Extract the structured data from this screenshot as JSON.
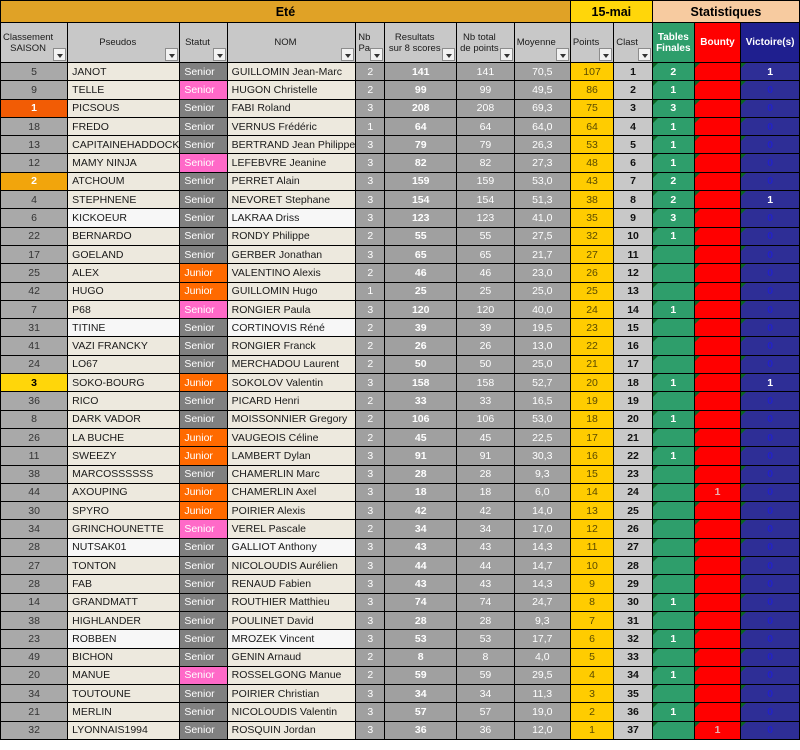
{
  "bands": {
    "season_title": "Eté",
    "date_label": "15-mai",
    "stats_label": "Statistiques"
  },
  "colors": {
    "season_band": "#E0A226",
    "date_band": "#FFD60A",
    "stats_band": "#F7CBA0",
    "tables_finales": "#2E9E6B",
    "bounty": "#FF0000",
    "victoires": "#1F1F8F",
    "points": "#FFCC00",
    "rank_gold1": "#F25C05",
    "rank_gold2": "#F2A50C",
    "rank_gold3": "#FFD60A",
    "statut_senior": "#808080",
    "statut_senior_female": "#FF69C8",
    "statut_junior": "#FF6A00"
  },
  "headers": [
    "Classement SAISON",
    "Pseudos",
    "Statut",
    "NOM",
    "Nb Pa",
    "Resultats sur 8 scores",
    "Nb total de points",
    "Moyenne",
    "Points",
    "Clast",
    "Tables Finales",
    "Bounty",
    "Victoire(s)"
  ],
  "rows": [
    {
      "rank": "5",
      "rank_hl": "",
      "pseudo": "JANOT",
      "statut": "Senior",
      "statut_type": "senior",
      "nom": "GUILLOMIN Jean-Marc",
      "nbpa": "2",
      "res8": "141",
      "nbtot": "141",
      "moy": "70,5",
      "pts": "107",
      "clst": "1",
      "tf": "2",
      "bounty": "",
      "vic": "1"
    },
    {
      "rank": "9",
      "rank_hl": "",
      "pseudo": "TELLE",
      "statut": "Senior",
      "statut_type": "senior-f",
      "nom": "HUGON Christelle",
      "nbpa": "2",
      "res8": "99",
      "nbtot": "99",
      "moy": "49,5",
      "pts": "86",
      "clst": "2",
      "tf": "1",
      "bounty": "",
      "vic": "0"
    },
    {
      "rank": "1",
      "rank_hl": "g1",
      "pseudo": "PICSOUS",
      "statut": "Senior",
      "statut_type": "senior",
      "nom": "FABI Roland",
      "nbpa": "3",
      "res8": "208",
      "nbtot": "208",
      "moy": "69,3",
      "pts": "75",
      "clst": "3",
      "tf": "3",
      "bounty": "",
      "vic": "0"
    },
    {
      "rank": "18",
      "rank_hl": "",
      "pseudo": "FREDO",
      "statut": "Senior",
      "statut_type": "senior",
      "nom": "VERNUS Frédéric",
      "nbpa": "1",
      "res8": "64",
      "nbtot": "64",
      "moy": "64,0",
      "pts": "64",
      "clst": "4",
      "tf": "1",
      "bounty": "",
      "vic": "0"
    },
    {
      "rank": "13",
      "rank_hl": "",
      "pseudo": "CAPITAINEHADDOCK",
      "statut": "Senior",
      "statut_type": "senior",
      "nom": "BERTRAND Jean Philippe",
      "nbpa": "3",
      "res8": "79",
      "nbtot": "79",
      "moy": "26,3",
      "pts": "53",
      "clst": "5",
      "tf": "1",
      "bounty": "",
      "vic": "0"
    },
    {
      "rank": "12",
      "rank_hl": "",
      "pseudo": "MAMY NINJA",
      "statut": "Senior",
      "statut_type": "senior-f",
      "nom": "LEFEBVRE Jeanine",
      "nbpa": "3",
      "res8": "82",
      "nbtot": "82",
      "moy": "27,3",
      "pts": "48",
      "clst": "6",
      "tf": "1",
      "bounty": "",
      "vic": "0"
    },
    {
      "rank": "2",
      "rank_hl": "g2",
      "pseudo": "ATCHOUM",
      "statut": "Senior",
      "statut_type": "senior",
      "nom": "PERRET Alain",
      "nbpa": "3",
      "res8": "159",
      "nbtot": "159",
      "moy": "53,0",
      "pts": "43",
      "clst": "7",
      "tf": "2",
      "bounty": "",
      "vic": "0"
    },
    {
      "rank": "4",
      "rank_hl": "",
      "pseudo": "STEPHNENE",
      "statut": "Senior",
      "statut_type": "senior",
      "nom": "NEVORET Stephane",
      "nbpa": "3",
      "res8": "154",
      "nbtot": "154",
      "moy": "51,3",
      "pts": "38",
      "clst": "8",
      "tf": "2",
      "bounty": "",
      "vic": "1"
    },
    {
      "rank": "6",
      "rank_hl": "",
      "pseudo": "KICKOEUR",
      "statut": "Senior",
      "statut_type": "senior",
      "nom": "LAKRAA Driss",
      "nbpa": "3",
      "res8": "123",
      "nbtot": "123",
      "moy": "41,0",
      "pts": "35",
      "clst": "9",
      "tf": "3",
      "bounty": "",
      "vic": "0"
    },
    {
      "rank": "22",
      "rank_hl": "",
      "pseudo": "BERNARDO",
      "statut": "Senior",
      "statut_type": "senior",
      "nom": "RONDY Philippe",
      "nbpa": "2",
      "res8": "55",
      "nbtot": "55",
      "moy": "27,5",
      "pts": "32",
      "clst": "10",
      "tf": "1",
      "bounty": "",
      "vic": "0"
    },
    {
      "rank": "17",
      "rank_hl": "",
      "pseudo": "GOELAND",
      "statut": "Senior",
      "statut_type": "senior",
      "nom": "GERBER Jonathan",
      "nbpa": "3",
      "res8": "65",
      "nbtot": "65",
      "moy": "21,7",
      "pts": "27",
      "clst": "11",
      "tf": "",
      "bounty": "",
      "vic": "0"
    },
    {
      "rank": "25",
      "rank_hl": "",
      "pseudo": "ALEX",
      "statut": "Junior",
      "statut_type": "junior",
      "nom": "VALENTINO Alexis",
      "nbpa": "2",
      "res8": "46",
      "nbtot": "46",
      "moy": "23,0",
      "pts": "26",
      "clst": "12",
      "tf": "",
      "bounty": "",
      "vic": "0"
    },
    {
      "rank": "42",
      "rank_hl": "",
      "pseudo": "HUGO",
      "statut": "Junior",
      "statut_type": "junior",
      "nom": "GUILLOMIN Hugo",
      "nbpa": "1",
      "res8": "25",
      "nbtot": "25",
      "moy": "25,0",
      "pts": "25",
      "clst": "13",
      "tf": "",
      "bounty": "",
      "vic": "0"
    },
    {
      "rank": "7",
      "rank_hl": "",
      "pseudo": "P68",
      "statut": "Senior",
      "statut_type": "senior-f",
      "nom": "RONGIER Paula",
      "nbpa": "3",
      "res8": "120",
      "nbtot": "120",
      "moy": "40,0",
      "pts": "24",
      "clst": "14",
      "tf": "1",
      "bounty": "",
      "vic": "0"
    },
    {
      "rank": "31",
      "rank_hl": "",
      "pseudo": "TITINE",
      "statut": "Senior",
      "statut_type": "senior",
      "nom": "CORTINOVIS Réné",
      "nbpa": "2",
      "res8": "39",
      "nbtot": "39",
      "moy": "19,5",
      "pts": "23",
      "clst": "15",
      "tf": "",
      "bounty": "",
      "vic": "0"
    },
    {
      "rank": "41",
      "rank_hl": "",
      "pseudo": "VAZI FRANCKY",
      "statut": "Senior",
      "statut_type": "senior",
      "nom": "RONGIER Franck",
      "nbpa": "2",
      "res8": "26",
      "nbtot": "26",
      "moy": "13,0",
      "pts": "22",
      "clst": "16",
      "tf": "",
      "bounty": "",
      "vic": "0"
    },
    {
      "rank": "24",
      "rank_hl": "",
      "pseudo": "LO67",
      "statut": "Senior",
      "statut_type": "senior",
      "nom": "MERCHADOU Laurent",
      "nbpa": "2",
      "res8": "50",
      "nbtot": "50",
      "moy": "25,0",
      "pts": "21",
      "clst": "17",
      "tf": "",
      "bounty": "",
      "vic": "0"
    },
    {
      "rank": "3",
      "rank_hl": "g3",
      "pseudo": "SOKO-BOURG",
      "statut": "Junior",
      "statut_type": "junior",
      "nom": "SOKOLOV Valentin",
      "nbpa": "3",
      "res8": "158",
      "nbtot": "158",
      "moy": "52,7",
      "pts": "20",
      "clst": "18",
      "tf": "1",
      "bounty": "",
      "vic": "1"
    },
    {
      "rank": "36",
      "rank_hl": "",
      "pseudo": "RICO",
      "statut": "Senior",
      "statut_type": "senior",
      "nom": "PICARD Henri",
      "nbpa": "2",
      "res8": "33",
      "nbtot": "33",
      "moy": "16,5",
      "pts": "19",
      "clst": "19",
      "tf": "",
      "bounty": "",
      "vic": "0"
    },
    {
      "rank": "8",
      "rank_hl": "",
      "pseudo": "DARK VADOR",
      "statut": "Senior",
      "statut_type": "senior",
      "nom": "MOISSONNIER Gregory",
      "nbpa": "2",
      "res8": "106",
      "nbtot": "106",
      "moy": "53,0",
      "pts": "18",
      "clst": "20",
      "tf": "1",
      "bounty": "",
      "vic": "0"
    },
    {
      "rank": "26",
      "rank_hl": "",
      "pseudo": "LA BUCHE",
      "statut": "Junior",
      "statut_type": "junior",
      "nom": "VAUGEOIS Céline",
      "nbpa": "2",
      "res8": "45",
      "nbtot": "45",
      "moy": "22,5",
      "pts": "17",
      "clst": "21",
      "tf": "",
      "bounty": "",
      "vic": "0"
    },
    {
      "rank": "11",
      "rank_hl": "",
      "pseudo": "SWEEZY",
      "statut": "Junior",
      "statut_type": "junior",
      "nom": "LAMBERT Dylan",
      "nbpa": "3",
      "res8": "91",
      "nbtot": "91",
      "moy": "30,3",
      "pts": "16",
      "clst": "22",
      "tf": "1",
      "bounty": "",
      "vic": "0"
    },
    {
      "rank": "38",
      "rank_hl": "",
      "pseudo": "MARCOSSSSSS",
      "statut": "Senior",
      "statut_type": "senior",
      "nom": "CHAMERLIN Marc",
      "nbpa": "3",
      "res8": "28",
      "nbtot": "28",
      "moy": "9,3",
      "pts": "15",
      "clst": "23",
      "tf": "",
      "bounty": "",
      "vic": "0"
    },
    {
      "rank": "44",
      "rank_hl": "",
      "pseudo": "AXOUPING",
      "statut": "Junior",
      "statut_type": "junior",
      "nom": "CHAMERLIN Axel",
      "nbpa": "3",
      "res8": "18",
      "nbtot": "18",
      "moy": "6,0",
      "pts": "14",
      "clst": "24",
      "tf": "",
      "bounty": "1",
      "vic": "0"
    },
    {
      "rank": "30",
      "rank_hl": "",
      "pseudo": "SPYRO",
      "statut": "Junior",
      "statut_type": "junior",
      "nom": "POIRIER Alexis",
      "nbpa": "3",
      "res8": "42",
      "nbtot": "42",
      "moy": "14,0",
      "pts": "13",
      "clst": "25",
      "tf": "",
      "bounty": "",
      "vic": "0"
    },
    {
      "rank": "34",
      "rank_hl": "",
      "pseudo": "GRINCHOUNETTE",
      "statut": "Senior",
      "statut_type": "senior-f",
      "nom": "VEREL Pascale",
      "nbpa": "2",
      "res8": "34",
      "nbtot": "34",
      "moy": "17,0",
      "pts": "12",
      "clst": "26",
      "tf": "",
      "bounty": "",
      "vic": "0"
    },
    {
      "rank": "28",
      "rank_hl": "",
      "pseudo": "NUTSAK01",
      "statut": "Senior",
      "statut_type": "senior",
      "nom": "GALLIOT Anthony",
      "nbpa": "3",
      "res8": "43",
      "nbtot": "43",
      "moy": "14,3",
      "pts": "11",
      "clst": "27",
      "tf": "",
      "bounty": "",
      "vic": "0"
    },
    {
      "rank": "27",
      "rank_hl": "",
      "pseudo": "TONTON",
      "statut": "Senior",
      "statut_type": "senior",
      "nom": "NICOLOUDIS Aurélien",
      "nbpa": "3",
      "res8": "44",
      "nbtot": "44",
      "moy": "14,7",
      "pts": "10",
      "clst": "28",
      "tf": "",
      "bounty": "",
      "vic": "0"
    },
    {
      "rank": "28",
      "rank_hl": "",
      "pseudo": "FAB",
      "statut": "Senior",
      "statut_type": "senior",
      "nom": "RENAUD Fabien",
      "nbpa": "3",
      "res8": "43",
      "nbtot": "43",
      "moy": "14,3",
      "pts": "9",
      "clst": "29",
      "tf": "",
      "bounty": "",
      "vic": "0"
    },
    {
      "rank": "14",
      "rank_hl": "",
      "pseudo": "GRANDMATT",
      "statut": "Senior",
      "statut_type": "senior",
      "nom": "ROUTHIER Matthieu",
      "nbpa": "3",
      "res8": "74",
      "nbtot": "74",
      "moy": "24,7",
      "pts": "8",
      "clst": "30",
      "tf": "1",
      "bounty": "",
      "vic": "0"
    },
    {
      "rank": "38",
      "rank_hl": "",
      "pseudo": "HIGHLANDER",
      "statut": "Senior",
      "statut_type": "senior",
      "nom": "POULINET David",
      "nbpa": "3",
      "res8": "28",
      "nbtot": "28",
      "moy": "9,3",
      "pts": "7",
      "clst": "31",
      "tf": "",
      "bounty": "",
      "vic": "0"
    },
    {
      "rank": "23",
      "rank_hl": "",
      "pseudo": "ROBBEN",
      "statut": "Senior",
      "statut_type": "senior",
      "nom": "MROZEK Vincent",
      "nbpa": "3",
      "res8": "53",
      "nbtot": "53",
      "moy": "17,7",
      "pts": "6",
      "clst": "32",
      "tf": "1",
      "bounty": "",
      "vic": "0"
    },
    {
      "rank": "49",
      "rank_hl": "",
      "pseudo": "BICHON",
      "statut": "Senior",
      "statut_type": "senior",
      "nom": "GENIN Arnaud",
      "nbpa": "2",
      "res8": "8",
      "nbtot": "8",
      "moy": "4,0",
      "pts": "5",
      "clst": "33",
      "tf": "",
      "bounty": "",
      "vic": "0"
    },
    {
      "rank": "20",
      "rank_hl": "",
      "pseudo": "MANUE",
      "statut": "Senior",
      "statut_type": "senior-f",
      "nom": "ROSSELGONG Manue",
      "nbpa": "2",
      "res8": "59",
      "nbtot": "59",
      "moy": "29,5",
      "pts": "4",
      "clst": "34",
      "tf": "1",
      "bounty": "",
      "vic": "0"
    },
    {
      "rank": "34",
      "rank_hl": "",
      "pseudo": "TOUTOUNE",
      "statut": "Senior",
      "statut_type": "senior",
      "nom": "POIRIER Christian",
      "nbpa": "3",
      "res8": "34",
      "nbtot": "34",
      "moy": "11,3",
      "pts": "3",
      "clst": "35",
      "tf": "",
      "bounty": "",
      "vic": "0"
    },
    {
      "rank": "21",
      "rank_hl": "",
      "pseudo": "MERLIN",
      "statut": "Senior",
      "statut_type": "senior",
      "nom": "NICOLOUDIS Valentin",
      "nbpa": "3",
      "res8": "57",
      "nbtot": "57",
      "moy": "19,0",
      "pts": "2",
      "clst": "36",
      "tf": "1",
      "bounty": "",
      "vic": "0"
    },
    {
      "rank": "32",
      "rank_hl": "",
      "pseudo": "LYONNAIS1994",
      "statut": "Senior",
      "statut_type": "senior",
      "nom": "ROSQUIN Jordan",
      "nbpa": "3",
      "res8": "36",
      "nbtot": "36",
      "moy": "12,0",
      "pts": "1",
      "clst": "37",
      "tf": "",
      "bounty": "1",
      "vic": "0"
    }
  ]
}
